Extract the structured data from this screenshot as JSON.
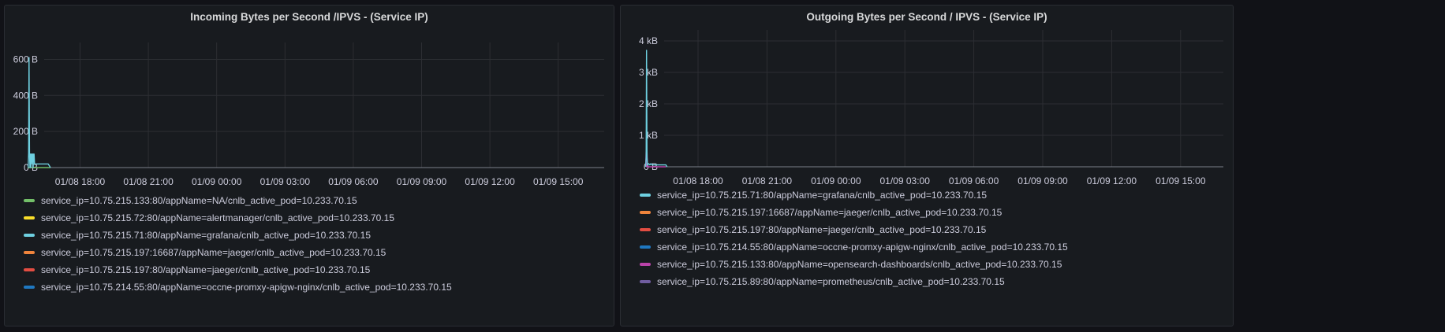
{
  "panels": [
    {
      "title": "Incoming Bytes per Second /IPVS - (Service IP)",
      "legend": [
        {
          "label": "service_ip=10.75.215.133:80/appName=NA/cnlb_active_pod=10.233.70.15",
          "color": "#73bf69"
        },
        {
          "label": "service_ip=10.75.215.72:80/appName=alertmanager/cnlb_active_pod=10.233.70.15",
          "color": "#fade2a"
        },
        {
          "label": "service_ip=10.75.215.71:80/appName=grafana/cnlb_active_pod=10.233.70.15",
          "color": "#6ed0e0"
        },
        {
          "label": "service_ip=10.75.215.197:16687/appName=jaeger/cnlb_active_pod=10.233.70.15",
          "color": "#ef843c"
        },
        {
          "label": "service_ip=10.75.215.197:80/appName=jaeger/cnlb_active_pod=10.233.70.15",
          "color": "#e24d42"
        },
        {
          "label": "service_ip=10.75.214.55:80/appName=occne-promxy-apigw-nginx/cnlb_active_pod=10.233.70.15",
          "color": "#1f78c1"
        }
      ],
      "chart_data": {
        "type": "line",
        "title": "Incoming Bytes per Second /IPVS - (Service IP)",
        "x_ticks": [
          "01/08 18:00",
          "01/08 21:00",
          "01/09 00:00",
          "01/09 03:00",
          "01/09 06:00",
          "01/09 09:00",
          "01/09 12:00",
          "01/09 15:00"
        ],
        "y_ticks": [
          "0 B",
          "200 B",
          "400 B",
          "600 B"
        ],
        "y_range": [
          0,
          650
        ],
        "x_range_hours_from_0000_0108": [
          15.5,
          32.3
        ],
        "grid": true,
        "legend_placement": "bottom",
        "series": [
          {
            "name": "service_ip=10.75.215.71:80/appName=grafana/cnlb_active_pod=10.233.70.15",
            "x": [
              15.72,
              15.74,
              15.76,
              15.78,
              15.8,
              15.82,
              15.84,
              15.86,
              15.88,
              15.9,
              15.92,
              15.94,
              15.96,
              15.98,
              16.0,
              16.05,
              16.1,
              16.2,
              16.35,
              16.5,
              16.6,
              16.7
            ],
            "values": [
              0,
              80,
              610,
              80,
              0,
              75,
              0,
              75,
              75,
              20,
              75,
              0,
              75,
              75,
              20,
              20,
              20,
              20,
              20,
              20,
              20,
              0
            ]
          },
          {
            "name": "service_ip=10.75.215.133:80/appName=NA/cnlb_active_pod=10.233.70.15",
            "x": [
              15.72,
              16.7
            ],
            "values": [
              0,
              0
            ]
          }
        ]
      }
    },
    {
      "title": "Outgoing Bytes per Second / IPVS - (Service IP)",
      "legend": [
        {
          "label": "service_ip=10.75.215.71:80/appName=grafana/cnlb_active_pod=10.233.70.15",
          "color": "#6ed0e0"
        },
        {
          "label": "service_ip=10.75.215.197:16687/appName=jaeger/cnlb_active_pod=10.233.70.15",
          "color": "#ef843c"
        },
        {
          "label": "service_ip=10.75.215.197:80/appName=jaeger/cnlb_active_pod=10.233.70.15",
          "color": "#e24d42"
        },
        {
          "label": "service_ip=10.75.214.55:80/appName=occne-promxy-apigw-nginx/cnlb_active_pod=10.233.70.15",
          "color": "#1f78c1"
        },
        {
          "label": "service_ip=10.75.215.133:80/appName=opensearch-dashboards/cnlb_active_pod=10.233.70.15",
          "color": "#ba43a9"
        },
        {
          "label": "service_ip=10.75.215.89:80/appName=prometheus/cnlb_active_pod=10.233.70.15",
          "color": "#705da0"
        }
      ],
      "chart_data": {
        "type": "line",
        "title": "Outgoing Bytes per Second / IPVS - (Service IP)",
        "x_ticks": [
          "01/08 18:00",
          "01/08 21:00",
          "01/09 00:00",
          "01/09 03:00",
          "01/09 06:00",
          "01/09 09:00",
          "01/09 12:00",
          "01/09 15:00"
        ],
        "y_ticks": [
          "0 B",
          "1 kB",
          "2 kB",
          "3 kB",
          "4 kB"
        ],
        "y_range": [
          0,
          4100
        ],
        "x_range_hours_from_0000_0108": [
          15.5,
          32.3
        ],
        "grid": true,
        "legend_placement": "bottom",
        "series": [
          {
            "name": "service_ip=10.75.215.71:80/appName=grafana/cnlb_active_pod=10.233.70.15",
            "x": [
              15.72,
              15.74,
              15.76,
              15.78,
              15.8,
              15.85,
              15.9,
              15.95,
              16.0,
              16.2,
              16.5,
              16.6,
              16.65
            ],
            "values": [
              0,
              300,
              3700,
              300,
              60,
              100,
              60,
              100,
              60,
              60,
              60,
              60,
              0
            ]
          },
          {
            "name": "service_ip=10.75.215.133:80/appName=opensearch-dashboards/cnlb_active_pod=10.233.70.15",
            "x": [
              15.72,
              15.74,
              15.76,
              15.78,
              15.8,
              16.6
            ],
            "values": [
              0,
              500,
              0,
              500,
              0,
              0
            ]
          }
        ]
      }
    }
  ]
}
